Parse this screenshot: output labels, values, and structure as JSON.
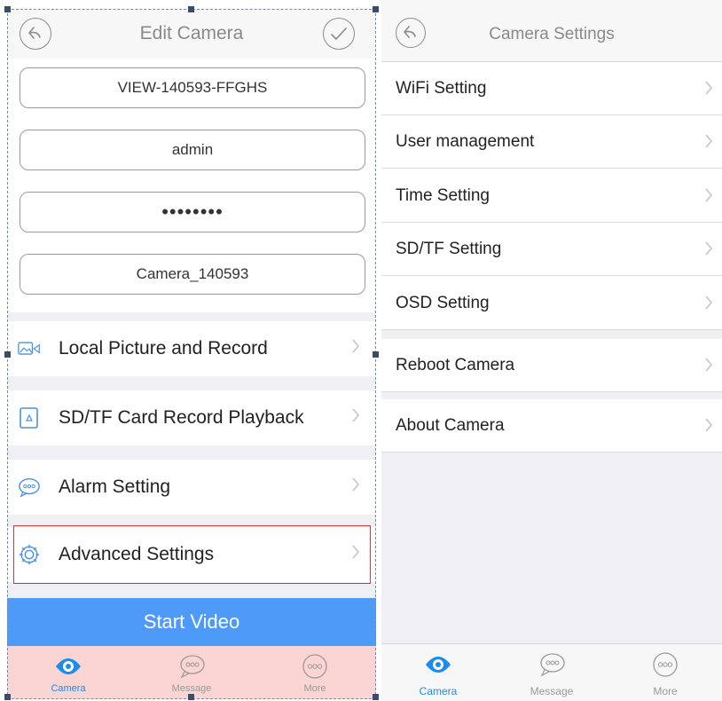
{
  "left": {
    "nav_title": "Edit Camera",
    "fields": [
      "VIEW-140593-FFGHS",
      "admin",
      "••••••••",
      "Camera_140593"
    ],
    "menu_items": [
      "Local Picture and Record",
      "SD/TF Card Record Playback",
      "Alarm Setting",
      "Advanced Settings"
    ],
    "start_button": "Start Video",
    "tabs": [
      "Camera",
      "Message",
      "More"
    ]
  },
  "right": {
    "nav_title": "Camera Settings",
    "group1": [
      "WiFi Setting",
      "User management",
      "Time Setting",
      "SD/TF Setting",
      "OSD Setting"
    ],
    "group2": [
      "Reboot Camera"
    ],
    "group3": [
      "About Camera"
    ],
    "tabs": [
      "Camera",
      "Message",
      "More"
    ]
  },
  "icons": {
    "back": "back-arrow-icon",
    "confirm": "checkmark-icon",
    "chevron": "chevron-right-icon",
    "camera_tab": "camera-eye-icon",
    "message_tab": "message-bubble-icon",
    "more_tab": "more-dots-icon"
  },
  "colors": {
    "accent": "#4d9af8",
    "tab_active": "#1a8cf0",
    "tab_inactive": "#9a9a9a",
    "highlight": "#d23a3a",
    "tabbar_left": "#fbd4d4"
  }
}
